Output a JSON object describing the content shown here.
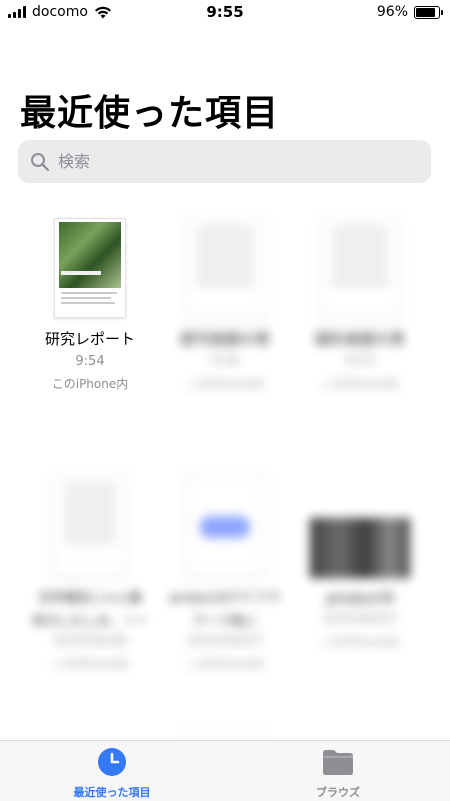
{
  "status": {
    "carrier": "docomo",
    "time": "9:55",
    "battery": "96%"
  },
  "page": {
    "title": "最近使った項目"
  },
  "search": {
    "placeholder": "検索"
  },
  "files": [
    {
      "name": "研究レポート",
      "time": "9:54",
      "location": "このiPhone内"
    },
    {
      "name": "提可画面の頁",
      "time": "9:56",
      "location": "このiPhone内"
    },
    {
      "name": "図形画面の頁",
      "time": "9:53",
      "location": "このiPhone内"
    },
    {
      "name": "文件報告じゃん基",
      "name2": "本のしたしみ、ーー",
      "time": "2020/06/08",
      "location": "このiPhone内"
    },
    {
      "name": "productの7ドフラ",
      "name2": "ワード転い",
      "time": "2020/06/07",
      "location": "このiPhone内"
    },
    {
      "name": "product9",
      "time": "2020/06/07",
      "location": "このiPhone内"
    }
  ],
  "tabs": [
    {
      "label": "最近使った項目",
      "color": "#3478f6"
    },
    {
      "label": "ブラウズ",
      "color": "#8e8e93"
    }
  ]
}
